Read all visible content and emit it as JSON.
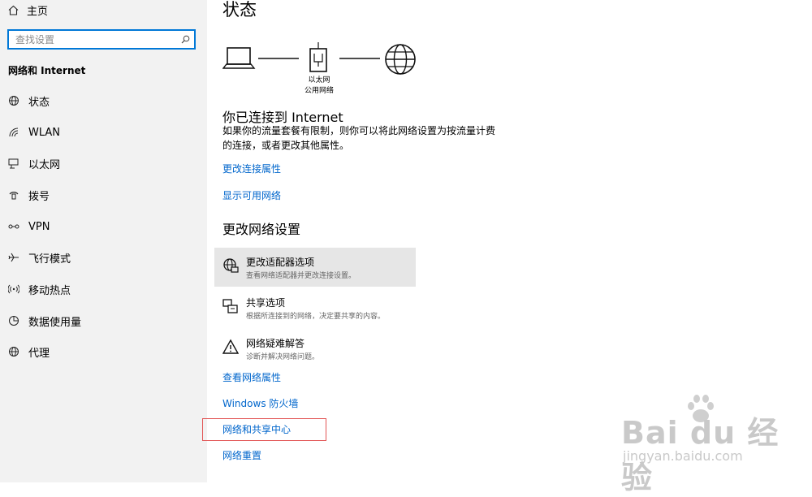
{
  "sidebar": {
    "home_label": "主页",
    "search_placeholder": "查找设置",
    "section_title": "网络和 Internet",
    "items": [
      {
        "label": "状态",
        "icon": "status-globe-icon"
      },
      {
        "label": "WLAN",
        "icon": "wifi-icon"
      },
      {
        "label": "以太网",
        "icon": "ethernet-icon"
      },
      {
        "label": "拨号",
        "icon": "dialup-icon"
      },
      {
        "label": "VPN",
        "icon": "vpn-icon"
      },
      {
        "label": "飞行模式",
        "icon": "airplane-icon"
      },
      {
        "label": "移动热点",
        "icon": "hotspot-icon"
      },
      {
        "label": "数据使用量",
        "icon": "data-usage-icon"
      },
      {
        "label": "代理",
        "icon": "proxy-globe-icon"
      }
    ]
  },
  "main": {
    "title": "状态",
    "diagram": {
      "adapter_name": "以太网",
      "network_type": "公用网络"
    },
    "connected_heading": "你已连接到 Internet",
    "connected_desc": "如果你的流量套餐有限制，则你可以将此网络设置为按流量计费的连接，或者更改其他属性。",
    "links_top": [
      "更改连接属性",
      "显示可用网络"
    ],
    "change_heading": "更改网络设置",
    "options": [
      {
        "title": "更改适配器选项",
        "desc": "查看网络适配器并更改连接设置。",
        "icon": "adapter-icon"
      },
      {
        "title": "共享选项",
        "desc": "根据所连接到的网络，决定要共享的内容。",
        "icon": "sharing-icon"
      },
      {
        "title": "网络疑难解答",
        "desc": "诊断并解决网络问题。",
        "icon": "warning-icon"
      }
    ],
    "links_bottom": [
      "查看网络属性",
      "Windows 防火墙",
      "网络和共享中心",
      "网络重置"
    ]
  },
  "watermark": {
    "brand": "Bai du 经验",
    "url": "jingyan.baidu.com"
  },
  "colors": {
    "accent": "#0078d7",
    "link": "#0066cc",
    "sidebar_bg": "#f2f2f2",
    "highlight": "#e6e6e6",
    "annotation_box": "#e25555"
  }
}
